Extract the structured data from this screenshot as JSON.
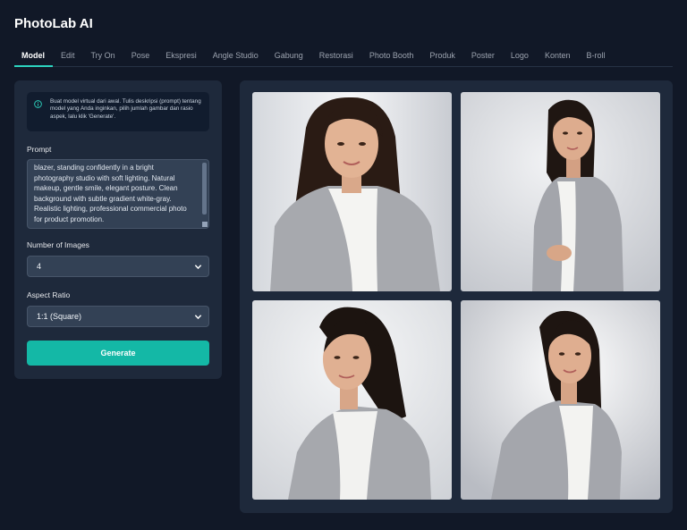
{
  "app": {
    "title": "PhotoLab AI"
  },
  "tabs": [
    {
      "label": "Model",
      "active": true
    },
    {
      "label": "Edit"
    },
    {
      "label": "Try On"
    },
    {
      "label": "Pose"
    },
    {
      "label": "Ekspresi"
    },
    {
      "label": "Angle Studio"
    },
    {
      "label": "Gabung"
    },
    {
      "label": "Restorasi"
    },
    {
      "label": "Photo Booth"
    },
    {
      "label": "Produk"
    },
    {
      "label": "Poster"
    },
    {
      "label": "Logo"
    },
    {
      "label": "Konten"
    },
    {
      "label": "B-roll"
    }
  ],
  "info": {
    "icon": "info-icon",
    "text": "Buat model virtual dari awal. Tulis deskripsi (prompt) tentang model yang Anda inginkan, pilih jumlah gambar dan rasio aspek, lalu klik 'Generate'."
  },
  "form": {
    "prompt_label": "Prompt",
    "prompt_value": "blazer, standing confidently in a bright\nphotography studio with soft lighting. Natural\nmakeup, gentle smile, elegant posture. Clean\nbackground with subtle gradient white-gray.\nRealistic lighting, professional commercial photo\nfor product promotion.",
    "images_label": "Number of Images",
    "images_value": "4",
    "aspect_label": "Aspect Ratio",
    "aspect_value": "1:1 (Square)",
    "generate_label": "Generate"
  },
  "results": [
    {
      "name": "generated-image-1"
    },
    {
      "name": "generated-image-2"
    },
    {
      "name": "generated-image-3"
    },
    {
      "name": "generated-image-4"
    }
  ],
  "colors": {
    "background": "#111827",
    "panel": "#1e293b",
    "accent": "#14b8a6",
    "input": "#334155"
  }
}
